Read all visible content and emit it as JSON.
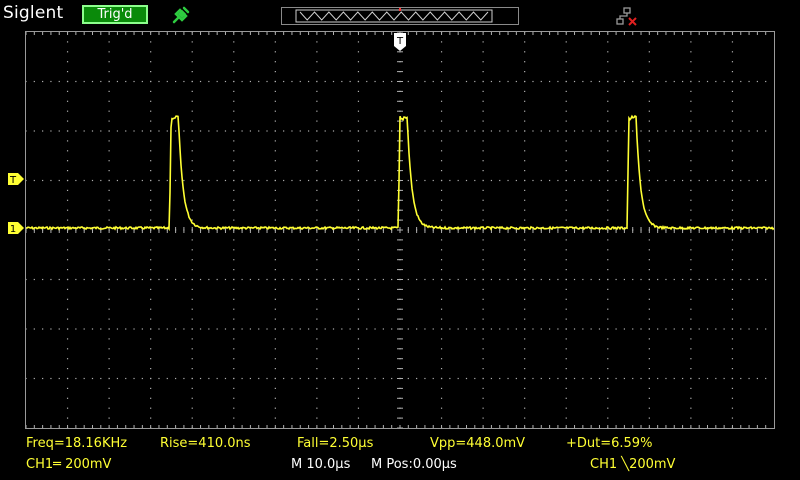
{
  "header": {
    "brand": "Siglent",
    "trigger_status": "Trig'd",
    "usb_icon": "usb-plug-icon",
    "network_icon": "network-disconnected-icon"
  },
  "colors": {
    "background": "#000000",
    "channel1": "#ffff33",
    "grid": "#b0b0b0",
    "trig_box": "#0a8a0a"
  },
  "display": {
    "h_divisions": 18,
    "v_divisions": 8,
    "trigger_marker": "T",
    "ch1_marker": "1",
    "trigger_level_marker": "T"
  },
  "measurements": {
    "freq": "Freq=18.16KHz",
    "rise": "Rise=410.0ns",
    "fall": "Fall=2.50µs",
    "vpp": "Vpp=448.0mV",
    "duty": "+Dut=6.59%"
  },
  "status": {
    "ch1_scale": "CH1═ 200mV",
    "timebase": "M 10.0µs",
    "mpos": "M Pos:0.00µs",
    "trigger": "CH1 ╲200mV"
  },
  "waveform": {
    "period_us": 55.07,
    "pulse_high_us": 1.75,
    "rise_ns": 410,
    "fall_us": 2.5,
    "vpp_mv": 448,
    "volts_per_div_mv": 200,
    "time_per_div_us": 10
  }
}
